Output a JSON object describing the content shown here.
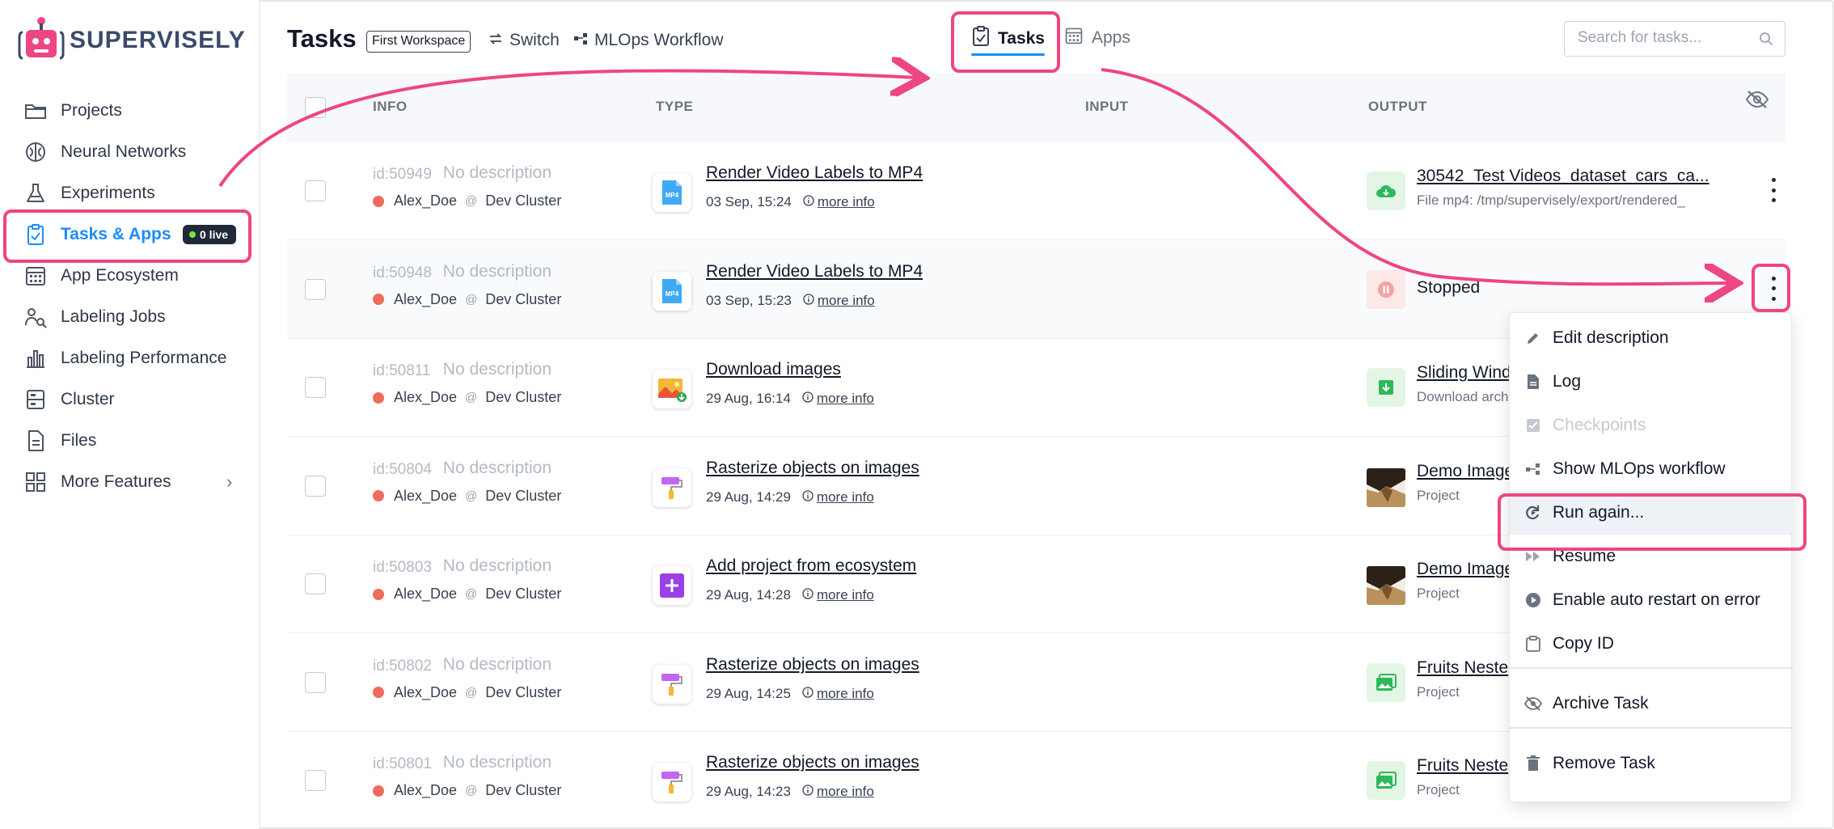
{
  "brand": {
    "name": "SUPERVISELY"
  },
  "sidebar": {
    "items": [
      {
        "label": "Projects",
        "icon": "folder-icon"
      },
      {
        "label": "Neural Networks",
        "icon": "brain-icon"
      },
      {
        "label": "Experiments",
        "icon": "flask-icon"
      },
      {
        "label": "Tasks & Apps",
        "icon": "clipboard-check-icon",
        "active": true,
        "badge": "0 live"
      },
      {
        "label": "App Ecosystem",
        "icon": "calendar-grid-icon"
      },
      {
        "label": "Labeling Jobs",
        "icon": "labeling-icon"
      },
      {
        "label": "Labeling Performance",
        "icon": "bar-chart-icon"
      },
      {
        "label": "Cluster",
        "icon": "server-icon"
      },
      {
        "label": "Files",
        "icon": "file-icon"
      },
      {
        "label": "More Features",
        "icon": "grid-icon",
        "chevron": "›"
      }
    ]
  },
  "header": {
    "title": "Tasks",
    "workspace": "First Workspace",
    "switch_label": "Switch",
    "mlops_label": "MLOps Workflow",
    "tabs": [
      {
        "label": "Tasks",
        "active": true
      },
      {
        "label": "Apps",
        "active": false
      }
    ],
    "search_placeholder": "Search for tasks..."
  },
  "table": {
    "columns": [
      "INFO",
      "TYPE",
      "INPUT",
      "OUTPUT"
    ],
    "rows": [
      {
        "id": "id:50949",
        "desc": "No description",
        "user": "Alex_Doe",
        "at": "@",
        "cluster": "Dev Cluster",
        "type": "Render Video Labels to MP4",
        "date": "03 Sep, 15:24",
        "more": "more info",
        "app_icon": "mp4-icon",
        "output_kind": "file",
        "output_title": "30542_Test Videos_dataset_cars_ca...",
        "output_sub": "File mp4: /tmp/supervisely/export/rendered_"
      },
      {
        "id": "id:50948",
        "desc": "No description",
        "user": "Alex_Doe",
        "at": "@",
        "cluster": "Dev Cluster",
        "type": "Render Video Labels to MP4",
        "date": "03 Sep, 15:23",
        "more": "more info",
        "app_icon": "mp4-icon",
        "output_kind": "stopped",
        "output_title": "Stopped",
        "output_sub": ""
      },
      {
        "id": "id:50811",
        "desc": "No description",
        "user": "Alex_Doe",
        "at": "@",
        "cluster": "Dev Cluster",
        "type": "Download images",
        "date": "29 Aug, 16:14",
        "more": "more info",
        "app_icon": "download-images-icon",
        "output_kind": "download",
        "output_title": "Sliding Wind",
        "output_sub": "Download arch"
      },
      {
        "id": "id:50804",
        "desc": "No description",
        "user": "Alex_Doe",
        "at": "@",
        "cluster": "Dev Cluster",
        "type": "Rasterize objects on images",
        "date": "29 Aug, 14:29",
        "more": "more info",
        "app_icon": "paint-roller-icon",
        "output_kind": "thumb",
        "output_title": "Demo Image",
        "output_sub": "Project"
      },
      {
        "id": "id:50803",
        "desc": "No description",
        "user": "Alex_Doe",
        "at": "@",
        "cluster": "Dev Cluster",
        "type": "Add project from ecosystem",
        "date": "29 Aug, 14:28",
        "more": "more info",
        "app_icon": "plus-icon",
        "output_kind": "thumb",
        "output_title": "Demo Image",
        "output_sub": "Project"
      },
      {
        "id": "id:50802",
        "desc": "No description",
        "user": "Alex_Doe",
        "at": "@",
        "cluster": "Dev Cluster",
        "type": "Rasterize objects on images",
        "date": "29 Aug, 14:25",
        "more": "more info",
        "app_icon": "paint-roller-icon",
        "output_kind": "image-project",
        "output_title": "Fruits Neste",
        "output_sub": "Project"
      },
      {
        "id": "id:50801",
        "desc": "No description",
        "user": "Alex_Doe",
        "at": "@",
        "cluster": "Dev Cluster",
        "type": "Rasterize objects on images",
        "date": "29 Aug, 14:23",
        "more": "more info",
        "app_icon": "paint-roller-icon",
        "output_kind": "image-project",
        "output_title": "Fruits Neste",
        "output_sub": "Project"
      }
    ]
  },
  "context_menu": {
    "items": [
      {
        "label": "Edit description",
        "icon": "pencil-icon"
      },
      {
        "label": "Log",
        "icon": "document-icon"
      },
      {
        "label": "Checkpoints",
        "icon": "checkbox-icon",
        "disabled": true
      },
      {
        "label": "Show MLOps workflow",
        "icon": "workflow-icon"
      },
      {
        "label": "Run again...",
        "icon": "rerun-icon",
        "highlighted": true
      },
      {
        "label": "Resume",
        "icon": "fast-forward-icon"
      },
      {
        "label": "Enable auto restart on error",
        "icon": "play-circle-icon"
      },
      {
        "label": "Copy ID",
        "icon": "clipboard-icon"
      },
      {
        "label": "Archive Task",
        "icon": "eye-off-icon"
      },
      {
        "label": "Remove Task",
        "icon": "trash-icon"
      }
    ]
  },
  "colors": {
    "accent": "#1a8cff",
    "annotation": "#ee4584",
    "status_red": "#ef6b5b",
    "badge_bg": "#1f2937",
    "live_green": "#7ee04b"
  }
}
